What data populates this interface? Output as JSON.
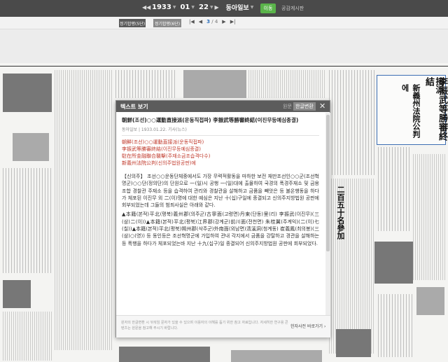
{
  "topbar": {
    "year": "1933",
    "month": "01",
    "day": "22",
    "publication": "동아일보",
    "go_label": "이동",
    "notice_label": "공감게시판"
  },
  "subbar": {
    "tab1": "정기합평(5단)",
    "tab2": "정기합평(6단)",
    "page_current": "3",
    "page_total": "4"
  },
  "newspaper": {
    "headline1": "朝鮮○○運動直接派",
    "headline2": "李振武等勝審終結",
    "headline3": "新義州法院公判에",
    "headline4": "二百五十名參加"
  },
  "modal": {
    "title": "텍스트 보기",
    "lang_original": "원문",
    "lang_korean": "한글변환",
    "close": "✕",
    "article_title_a": "朝鮮(조선)○○運動直接派(운동직접파) ",
    "article_title_b": "李振武等勝審終結(이진무등예심종결)",
    "meta": "동아일보 | 1933.01.22. 기사(뉴스)",
    "sub1_a": "朝鮮(조선)○○運動直接派(운동직접파)",
    "sub2_a": "李振武等勝審終結(이진무등예심종결)",
    "sub3_a": "駐在所金融聯合襲擊(주재소금조습격다수)",
    "sub4_a": "新義州法院公判(신의주법원공판)에",
    "body": "【신의주】 조선○○운동단체중에서도 가장 무력적활동을 마하한 보전 재만조선인○○군(조선혁명군)○○단(정의단)의 단원으로 一(일)시 공행 一(일)대에 출몰하여 국경의 폭경주재소 및 금용조합 경찰관 주재소 등을 습격하여 관리와 경찰관을 살해하고 금품을 빼앗은 등 불온행동을 하다가 체포된 이진무 외 二(이)명에 대한 예심은 지난 十(십)구일에 종결되고 신의주지방법원 공판에 회부되었는데 그들의 범죄사실은 아래와 같다.",
    "body2": "▲本籍(본적)平北(평북)義州郡(의주군)古寧面(고령면)丹東(단동)里(리) 李振武(이진무)(三(삼)二(이))▲本籍(본적)平北(평북)江界郡(강계군)前川面(전천면) 朱桂翼(주계익)(二(이)七(칠))▲本籍(본적)平北(평북)朔州郡(삭주군)外南面(외남면)淸溪洞(청계동) 崔義鳳(최의봉)(三(삼)○(영)) 등 동인등은 조선혁명군에 가입하여 관내 각지에서 금품을 강탈하고 경관을 살해하는 등 폭행을 하다가 체포되었는바 지난 十九(십구)일 종결되어 신의주지방법원 공판에 회부되었다.",
    "footnote": "원자의 한글변환 시 뒤섞임 문자가 있을 수 있으며 이용자의 이해를 돕기 위한 참고 자료입니다. 자세히한 연구용 콘텐츠는 원문을 참고해 주시기 바랍니다.",
    "footlink": "한자사전 바로가기 ›"
  }
}
